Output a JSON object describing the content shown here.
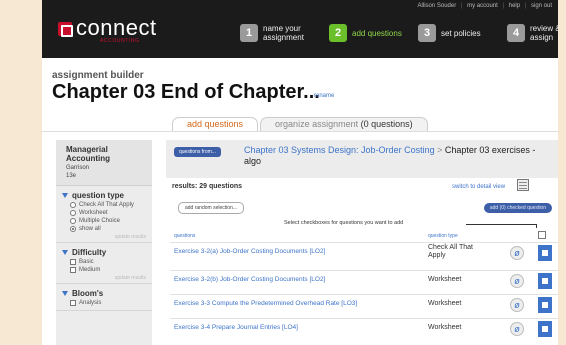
{
  "header": {
    "user": "Allison Souder",
    "util_links": [
      "my account",
      "help",
      "sign out"
    ],
    "logo": "connect",
    "logo_sub": "ACCOUNTING",
    "steps": [
      {
        "num": "1",
        "label": "name your assignment",
        "active": false
      },
      {
        "num": "2",
        "label": "add questions",
        "active": true
      },
      {
        "num": "3",
        "label": "set policies",
        "active": false
      },
      {
        "num": "4",
        "label": "review & assign",
        "active": false
      }
    ]
  },
  "breadcrumb": "assignment builder",
  "title": "Chapter 03 End of Chapter...",
  "rename": "rename",
  "tabs": {
    "add": "add questions",
    "organize": "organize assignment",
    "organize_count": "(0 questions)"
  },
  "sidebar": {
    "book_title": "Managerial Accounting",
    "author": "Garrison",
    "edition": "13e",
    "filters": [
      {
        "name": "question type",
        "kind": "radio",
        "options": [
          {
            "label": "Check All That Apply",
            "on": false
          },
          {
            "label": "Worksheet",
            "on": false
          },
          {
            "label": "Multiple Choice",
            "on": false
          },
          {
            "label": "show all",
            "on": true
          }
        ],
        "update": "update results"
      },
      {
        "name": "Difficulty",
        "kind": "checkbox",
        "options": [
          {
            "label": "Basic"
          },
          {
            "label": "Medium"
          }
        ],
        "update": "update results"
      },
      {
        "name": "Bloom's",
        "kind": "checkbox",
        "options": [
          {
            "label": "Analysis"
          }
        ]
      }
    ]
  },
  "source": {
    "button": "questions from...",
    "link": "Chapter 03 Systems Design: Job-Order Costing",
    "sep": ">",
    "current": "Chapter 03 exercises - algo"
  },
  "results": {
    "label": "results: 29 questions",
    "switch_view": "switch to detail view",
    "add_random": "add random selection...",
    "add_checked": "add (0) checked question",
    "instruction": "Select checkboxes for questions you want to add"
  },
  "table": {
    "col_question": "questions",
    "col_type": "question type",
    "rows": [
      {
        "question": "Exercise 3-2(a) Job-Order Costing Documents [LO2]",
        "type": "Check All That Apply"
      },
      {
        "question": "Exercise 3-2(b) Job-Order Costing Documents [LO2]",
        "type": "Worksheet"
      },
      {
        "question": "Exercise 3-3 Compute the Predetermined Overhead Rate [LO3]",
        "type": "Worksheet"
      },
      {
        "question": "Exercise 3-4 Prepare Journal Entries [LO4]",
        "type": "Worksheet"
      }
    ]
  },
  "colors": {
    "brand_red": "#c8102e",
    "active_step": "#6bbf2a",
    "link_blue": "#3d74c9",
    "tab_orange": "#d2681a"
  }
}
